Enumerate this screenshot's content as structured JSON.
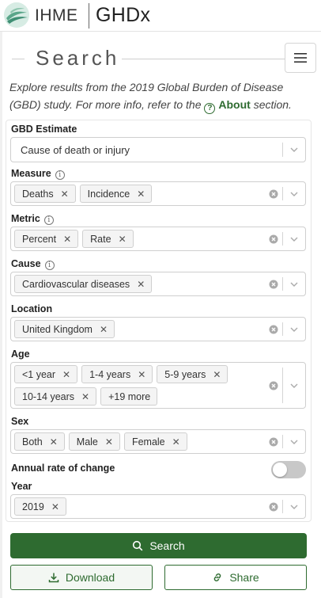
{
  "header": {
    "brand": "IHME",
    "product": "GHDx"
  },
  "panel": {
    "title": "Search",
    "intro_text": "Explore results from the 2019 Global Burden of Disease (GBD) study. For more info, refer to the ",
    "about_link": "About",
    "intro_suffix": " section."
  },
  "fields": {
    "gbd_estimate": {
      "label": "GBD Estimate",
      "value": "Cause of death or injury"
    },
    "measure": {
      "label": "Measure",
      "tags": [
        "Deaths",
        "Incidence"
      ]
    },
    "metric": {
      "label": "Metric",
      "tags": [
        "Percent",
        "Rate"
      ]
    },
    "cause": {
      "label": "Cause",
      "tags": [
        "Cardiovascular diseases"
      ]
    },
    "location": {
      "label": "Location",
      "tags": [
        "United Kingdom"
      ]
    },
    "age": {
      "label": "Age",
      "tags": [
        "<1 year",
        "1-4 years",
        "5-9 years",
        "10-14 years"
      ],
      "more": "+19 more"
    },
    "sex": {
      "label": "Sex",
      "tags": [
        "Both",
        "Male",
        "Female"
      ]
    },
    "annual_rate": {
      "label": "Annual rate of change",
      "enabled": false
    },
    "year": {
      "label": "Year",
      "tags": [
        "2019"
      ]
    }
  },
  "actions": {
    "search_label": "Search",
    "download_label": "Download",
    "share_label": "Share"
  },
  "colors": {
    "primary": "#2e6b30",
    "toggle_off": "#c8c8c8",
    "tag_bg": "#f4f4f4"
  }
}
